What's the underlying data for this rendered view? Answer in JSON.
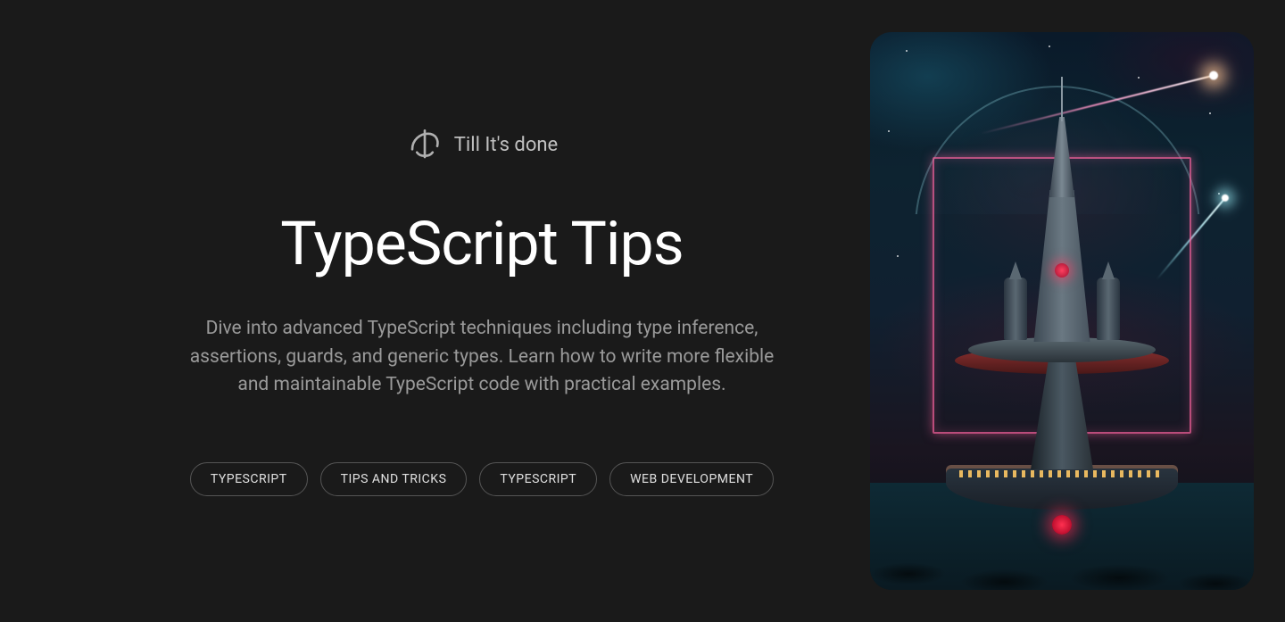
{
  "brand": {
    "name": "Till It's done"
  },
  "hero": {
    "title": "TypeScript Tips",
    "description": "Dive into advanced TypeScript techniques including type inference, assertions, guards, and generic types. Learn how to write more flexible and maintainable TypeScript code with practical examples."
  },
  "tags": [
    "TYPESCRIPT",
    "TIPS AND TRICKS",
    "TYPESCRIPT",
    "WEB DEVELOPMENT"
  ]
}
